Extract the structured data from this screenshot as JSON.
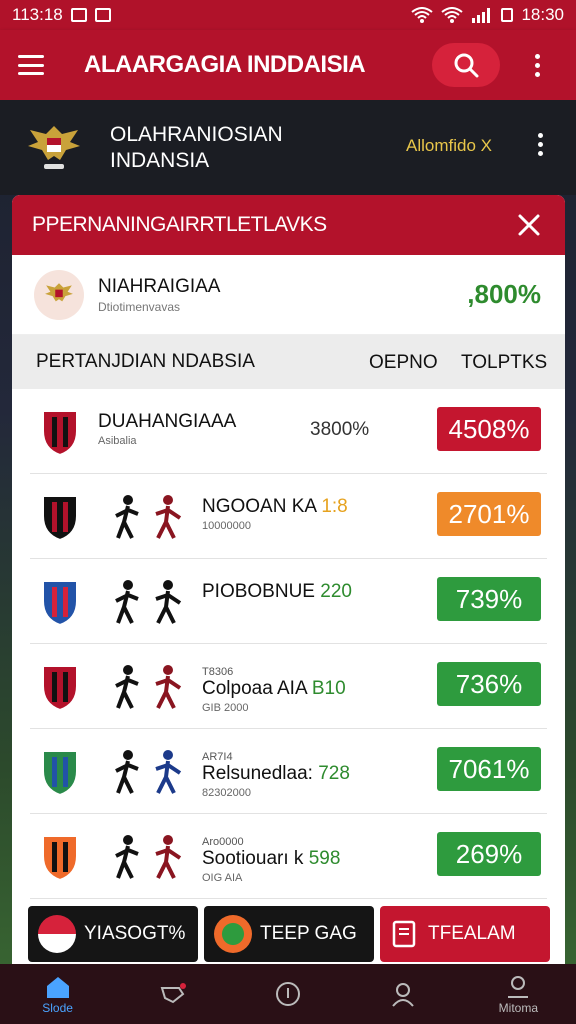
{
  "status_bar": {
    "time_left": "113:18",
    "time_right": "18:30"
  },
  "app_bar": {
    "title": "ALAARGAGIA INDDAISIA"
  },
  "sub_header": {
    "title": "OLAHRANIOSIAN INDANSIA",
    "action": "Allomfido X"
  },
  "card": {
    "title": "PPERNANINGAIRRTLETLAVKS",
    "featured": {
      "name": "NIAHRAIGIAA",
      "sub": "Dtiotimenvavas",
      "pct": ",800%"
    },
    "table_head": {
      "col_main": "PERTANJDIAN NDABSIA",
      "col_a": "OEPNO",
      "col_b": "TOLPTKS"
    },
    "rows": [
      {
        "top": "",
        "name": "DUAHANGIAAA",
        "highlight": "",
        "sub": "Asibalia",
        "mid": "3800%",
        "badge": "4508%",
        "color": "#c4162f"
      },
      {
        "top": "",
        "name": "NGOOAN KA",
        "highlight": "1:8",
        "sub": "10000000",
        "mid": "",
        "badge": "2701%",
        "color": "#ef8a2a"
      },
      {
        "top": "",
        "name": "PIOBOBNUE",
        "highlight": "220",
        "sub": "",
        "mid": "",
        "badge": "739%",
        "color": "#2e9b3e"
      },
      {
        "top": "T8306",
        "name": "Colpoaa AIA",
        "highlight": "B10",
        "sub": "GIB 2000",
        "mid": "",
        "badge": "736%",
        "color": "#2e9b3e"
      },
      {
        "top": "AR7I4",
        "name": "Relsunedlaa:",
        "highlight": "728",
        "sub": "82302000",
        "mid": "",
        "badge": "7061%",
        "color": "#2e9b3e"
      },
      {
        "top": "Aro0000",
        "name": "Sootiouarı k",
        "highlight": "598",
        "sub": "OIG AIA",
        "mid": "",
        "badge": "269%",
        "color": "#2e9b3e"
      }
    ]
  },
  "actions": {
    "a1": "YIASOGT%",
    "a2": "TEEP GAG",
    "a3": "TFEALAM"
  },
  "nav": {
    "home": "Slode",
    "profile": "Mitoma"
  }
}
